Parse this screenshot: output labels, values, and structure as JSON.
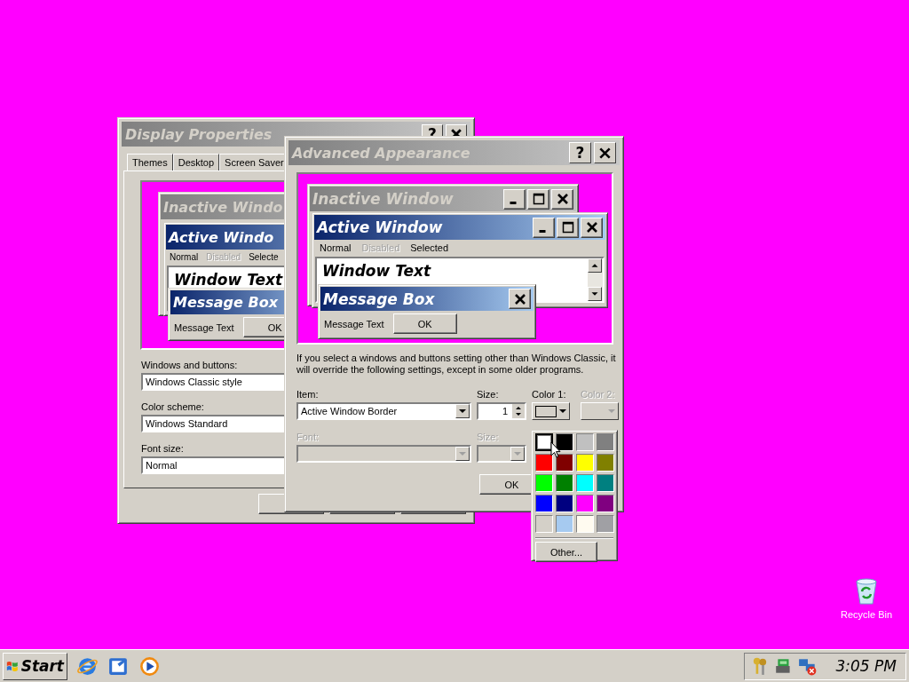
{
  "desktop": {
    "icons": [
      {
        "label": "Recycle Bin"
      }
    ]
  },
  "display_properties": {
    "title": "Display Properties",
    "help": "?",
    "tabs": [
      {
        "label": "Themes",
        "selected": false
      },
      {
        "label": "Desktop",
        "selected": false
      },
      {
        "label": "Screen Saver",
        "selected": false
      }
    ],
    "preview": {
      "inactive_title": "Inactive Windo",
      "active_title": "Active Windo",
      "menu": [
        {
          "label": "Normal",
          "disabled": false
        },
        {
          "label": "Disabled",
          "disabled": true
        },
        {
          "label": "Selecte",
          "disabled": false
        }
      ],
      "window_text": "Window Text",
      "message_title": "Message Box",
      "message_text": "Message Text",
      "ok": "OK"
    },
    "fields": [
      {
        "label": "Windows and buttons:",
        "value": "Windows Classic style"
      },
      {
        "label": "Color scheme:",
        "value": "Windows Standard"
      },
      {
        "label": "Font size:",
        "value": "Normal"
      }
    ]
  },
  "advanced_appearance": {
    "title": "Advanced Appearance",
    "help": "?",
    "preview": {
      "inactive_title": "Inactive Window",
      "active_title": "Active Window",
      "menu": [
        {
          "label": "Normal",
          "disabled": false
        },
        {
          "label": "Disabled",
          "disabled": true
        },
        {
          "label": "Selected",
          "disabled": false
        }
      ],
      "window_text": "Window Text",
      "message_title": "Message Box",
      "message_text": "Message Text",
      "ok": "OK"
    },
    "note": "If you select a windows and buttons setting other than Windows Classic, it will override the following settings, except in some older programs.",
    "item": {
      "label": "Item:",
      "value": "Active Window Border"
    },
    "size": {
      "label": "Size:",
      "value": "1"
    },
    "color1": {
      "label": "Color 1:",
      "color": "#d4d0c8"
    },
    "color2": {
      "label": "Color 2:",
      "disabled": true
    },
    "font": {
      "label": "Font:",
      "disabled": true
    },
    "font_size": {
      "label": "Size:",
      "disabled": true
    },
    "ok": "OK"
  },
  "color_picker": {
    "swatches": [
      {
        "color": "#ffffff",
        "selected": true
      },
      {
        "color": "#000000",
        "selected": false
      },
      {
        "color": "#c0c0c0",
        "selected": false
      },
      {
        "color": "#808080",
        "selected": false
      },
      {
        "color": "#ff0000",
        "selected": false
      },
      {
        "color": "#800000",
        "selected": false
      },
      {
        "color": "#ffff00",
        "selected": false
      },
      {
        "color": "#808000",
        "selected": false
      },
      {
        "color": "#00ff00",
        "selected": false
      },
      {
        "color": "#008000",
        "selected": false
      },
      {
        "color": "#00ffff",
        "selected": false
      },
      {
        "color": "#008080",
        "selected": false
      },
      {
        "color": "#0000ff",
        "selected": false
      },
      {
        "color": "#000080",
        "selected": false
      },
      {
        "color": "#ff00ff",
        "selected": false
      },
      {
        "color": "#800080",
        "selected": false
      },
      {
        "color": "#d4d0c8",
        "selected": false
      },
      {
        "color": "#a6caf0",
        "selected": false
      },
      {
        "color": "#fffbf0",
        "selected": false
      },
      {
        "color": "#a0a0a4",
        "selected": false
      }
    ],
    "other": "Other..."
  },
  "taskbar": {
    "start": "Start",
    "clock": "3:05 PM"
  }
}
